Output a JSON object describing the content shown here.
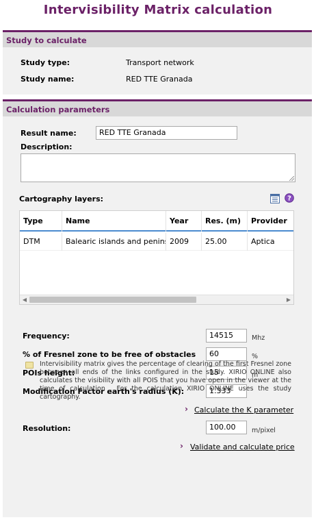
{
  "page": {
    "title": "Intervisibility Matrix calculation"
  },
  "study": {
    "header": "Study to calculate",
    "type_label": "Study type:",
    "type_value": "Transport network",
    "name_label": "Study name:",
    "name_value": "RED TTE Granada"
  },
  "params": {
    "header": "Calculation parameters",
    "result_name_label": "Result name:",
    "result_name_value": "RED TTE Granada",
    "description_label": "Description:",
    "description_value": "",
    "layers_label": "Cartography layers:",
    "layers_columns": [
      "Type",
      "Name",
      "Year",
      "Res. (m)",
      "Provider"
    ],
    "layers_rows": [
      {
        "type": "DTM",
        "name": "Balearic islands and penins",
        "year": "2009",
        "res": "25.00",
        "provider": "Aptica"
      }
    ],
    "frequency_label": "Frequency:",
    "frequency_value": "14515",
    "frequency_unit": "Mhz",
    "fresnel_label": "% of Fresnel zone to be free of obstacles",
    "fresnel_value": "60",
    "fresnel_unit": "%",
    "pois_label": "POIs height:",
    "pois_value": "15",
    "pois_unit": "m",
    "kfactor_label": "Modification Factor earth's radius (K):",
    "kfactor_value": "1.333",
    "calc_k_link": "Calculate the K parameter",
    "resolution_label": "Resolution:",
    "resolution_value": "100.00",
    "resolution_unit": "m/pixel",
    "validate_link": "Validate and calculate price",
    "note": "Intervisibility matrix gives the percentage of clearing of the first Fresnel zone between all ends of the links configured in the study. XIRIO ONLINE also calculates the visibility with all POIS that you have open in the viewer at the time of calculation . For the calculation XIRIO ONLINE uses the study cartography."
  }
}
